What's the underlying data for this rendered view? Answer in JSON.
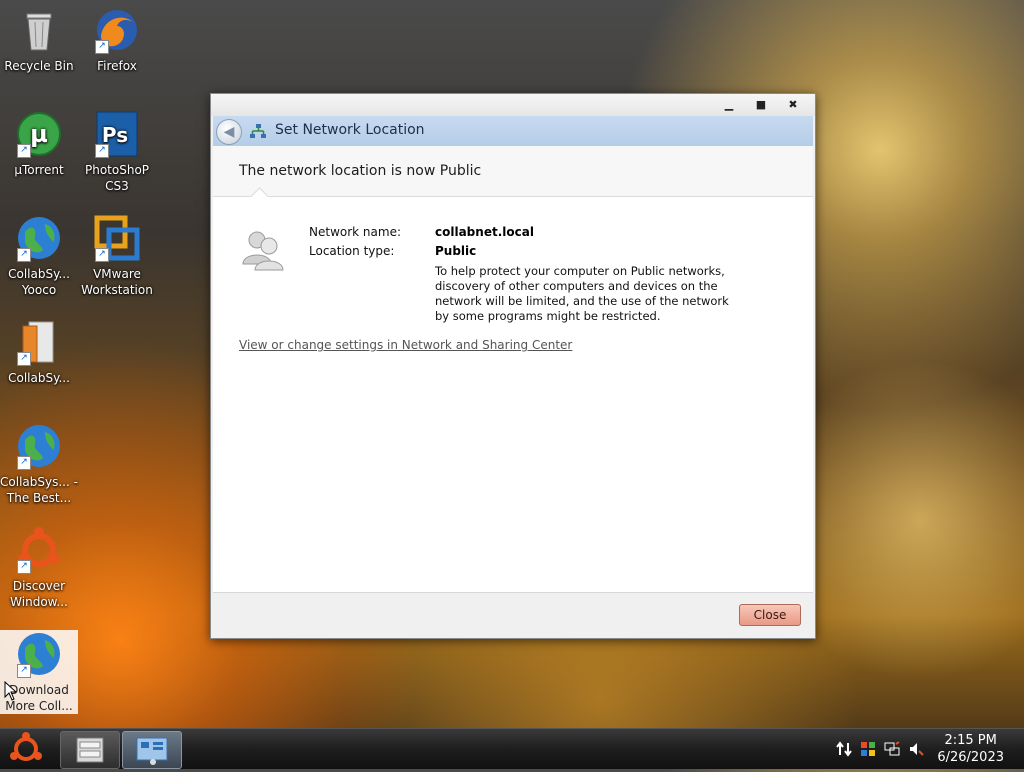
{
  "desktop": {
    "icons": [
      {
        "label": "Recycle Bin",
        "icon": "recycle-bin-icon"
      },
      {
        "label": "Firefox",
        "icon": "firefox-icon"
      },
      {
        "label": "µTorrent",
        "icon": "utorrent-icon"
      },
      {
        "label": "PhotoShoP CS3",
        "icon": "photoshop-icon"
      },
      {
        "label": "CollabSy... Yooco",
        "icon": "globe-icon"
      },
      {
        "label": "VMware Workstation",
        "icon": "vmware-icon"
      },
      {
        "label": "CollabSy...",
        "icon": "collabsys-box-icon"
      },
      {
        "label": "CollabSys... - The Best...",
        "icon": "globe-icon"
      },
      {
        "label": "Discover Window...",
        "icon": "ubuntu-icon"
      },
      {
        "label": "Download More Coll...",
        "icon": "globe-icon"
      }
    ]
  },
  "window": {
    "title": "Set Network Location",
    "heading": "The network location is now Public",
    "network_name_label": "Network name:",
    "network_name_value": "collabnet.local",
    "location_type_label": "Location type:",
    "location_type_value": "Public",
    "description": "To help protect your computer on Public networks, discovery of other computers and devices on the network will be limited, and the use of the network by some programs might be restricted.",
    "link": "View or change settings in Network and Sharing Center",
    "close_label": "Close",
    "minimize_glyph": "▁",
    "maximize_glyph": "■",
    "close_glyph": "✖"
  },
  "taskbar": {
    "time": "2:15 PM",
    "date": "6/26/2023"
  },
  "colors": {
    "address_bar": "#b4cde8",
    "close_button": "#e89a86",
    "link": "#555555"
  }
}
